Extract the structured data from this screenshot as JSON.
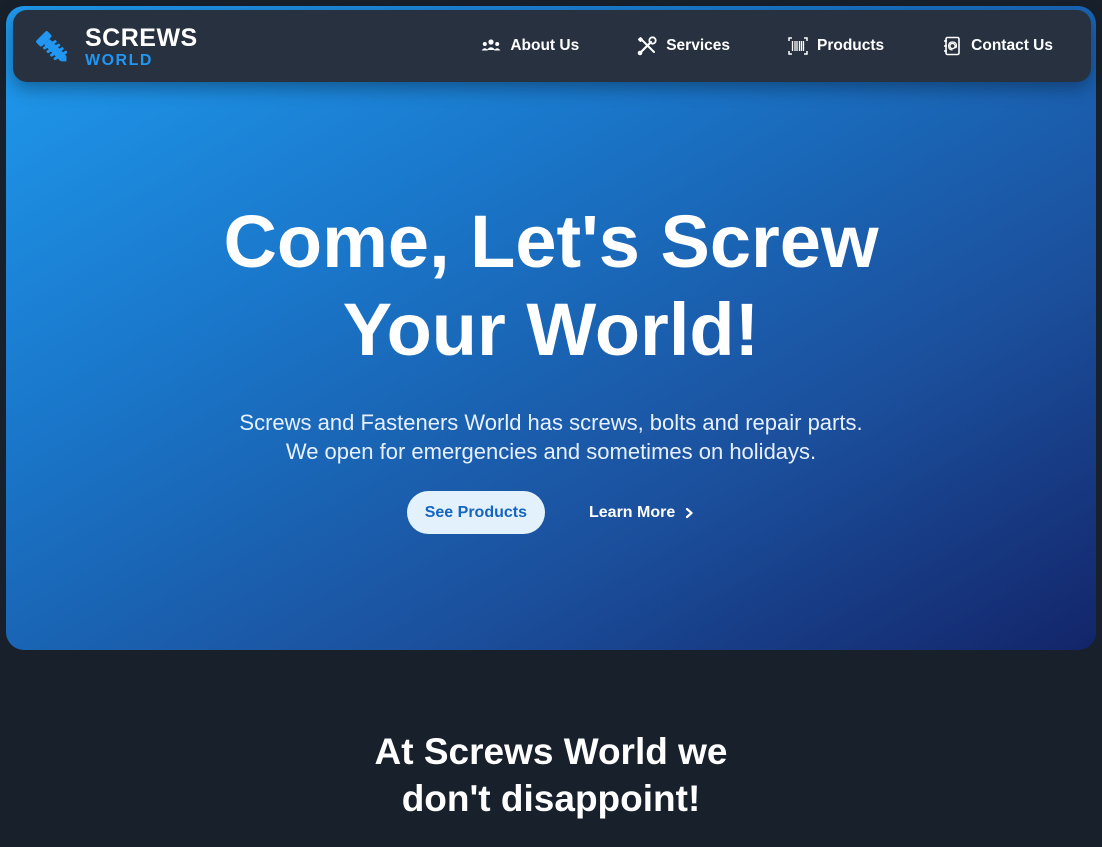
{
  "brand": {
    "name_top": "SCREWS",
    "name_bottom": "WORLD",
    "icon": "screw-icon",
    "accent_color": "#2196f3"
  },
  "nav": {
    "items": [
      {
        "label": "About Us",
        "icon": "users-icon"
      },
      {
        "label": "Services",
        "icon": "tools-icon"
      },
      {
        "label": "Products",
        "icon": "barcode-icon"
      },
      {
        "label": "Contact Us",
        "icon": "address-book-icon"
      }
    ]
  },
  "hero": {
    "headline_line1": "Come, Let's Screw",
    "headline_line2": "Your World!",
    "subtext_line1": "Screws and Fasteners World has screws, bolts and repair parts.",
    "subtext_line2": "We open for emergencies and sometimes on holidays.",
    "primary_cta": "See Products",
    "secondary_cta": "Learn More",
    "secondary_cta_icon": "chevron-right-icon"
  },
  "section": {
    "title_line1": "At Screws World we",
    "title_line2": "don't disappoint!"
  },
  "colors": {
    "page_bg": "#17202b",
    "nav_bg": "#27313f",
    "hero_gradient_start": "#1f9bef",
    "hero_gradient_end": "#13256a",
    "primary_button_bg": "#e3f1fc",
    "primary_button_text": "#1565c0"
  }
}
